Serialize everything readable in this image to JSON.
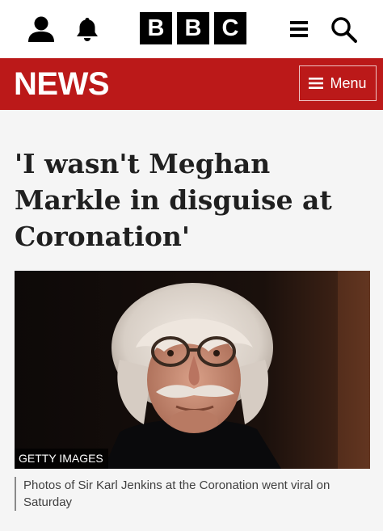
{
  "header": {
    "logo_letters": [
      "B",
      "B",
      "C"
    ],
    "icons": [
      "account-icon",
      "notifications-bell-icon",
      "hamburger-menu-icon",
      "search-icon"
    ]
  },
  "news_bar": {
    "title": "NEWS",
    "menu_label": "Menu",
    "background": "#bb1919"
  },
  "article": {
    "headline": "'I wasn't Meghan Markle in disguise at Coronation'",
    "image": {
      "credit": "GETTY IMAGES"
    },
    "caption": "Photos of Sir Karl Jenkins at the Coronation went viral on Saturday"
  }
}
